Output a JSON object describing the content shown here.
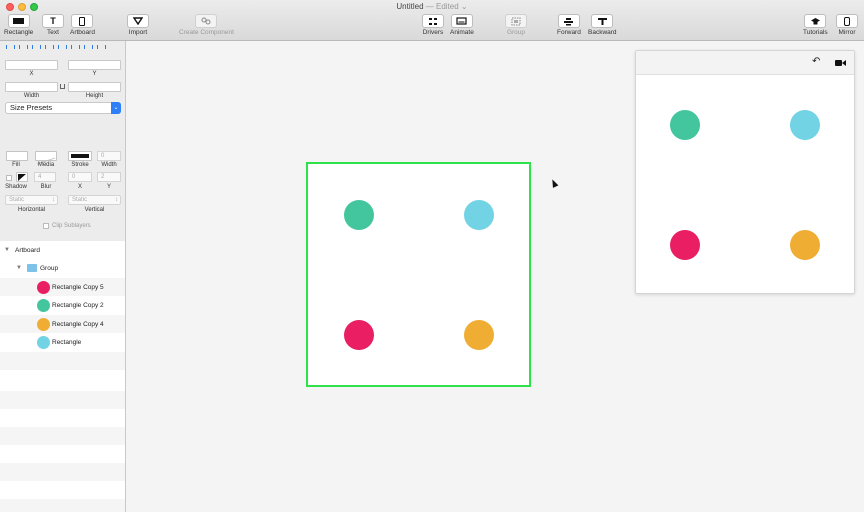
{
  "window": {
    "title": "Untitled",
    "title_separator": "—",
    "status": "Edited",
    "status_chevron": "⌄"
  },
  "toolbar": {
    "rectangle": "Rectangle",
    "text": "Text",
    "text_icon_glyph": "T",
    "artboard": "Artboard",
    "import": "Import",
    "create_component": "Create Component",
    "drivers": "Drivers",
    "animate": "Animate",
    "group": "Group",
    "forward": "Forward",
    "backward": "Backward",
    "tutorials": "Tutorials",
    "mirror": "Mirror"
  },
  "inspector": {
    "x_label": "X",
    "y_label": "Y",
    "width_label": "Width",
    "height_label": "Height",
    "size_presets": "Size Presets",
    "presets_arrow": "⌄",
    "fill_label": "Fill",
    "media_label": "Media",
    "stroke_label": "Stroke",
    "stroke_width_label": "Width",
    "stroke_width_value": "0",
    "shadow_label": "Shadow",
    "blur_label": "Blur",
    "shadow_x_label": "X",
    "shadow_y_label": "Y",
    "blur_value": "4",
    "shadow_x_value": "0",
    "shadow_y_value": "2",
    "horizontal_value": "Static",
    "vertical_value": "Static",
    "horizontal_label": "Horizontal",
    "vertical_label": "Vertical",
    "clip_sublayers": "Clip Sublayers"
  },
  "layers": {
    "artboard": "Artboard",
    "group": "Group",
    "items": [
      {
        "name": "Rectangle Copy 5",
        "color": "#e91e63"
      },
      {
        "name": "Rectangle Copy 2",
        "color": "#43c59e"
      },
      {
        "name": "Rectangle Copy 4",
        "color": "#f0ad33"
      },
      {
        "name": "Rectangle",
        "color": "#72d3e5"
      }
    ]
  },
  "colors": {
    "artboard_border": "#2ee24a",
    "green": "#43c59e",
    "cyan": "#72d3e5",
    "pink": "#e91e63",
    "orange": "#f0ad33"
  },
  "preview": {
    "undo_icon": "↶",
    "camera_icon": "■"
  }
}
